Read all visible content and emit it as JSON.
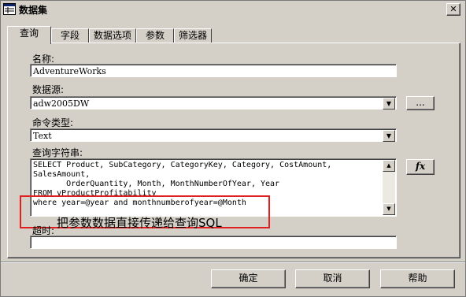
{
  "window": {
    "title": "数据集",
    "close_glyph": "✕"
  },
  "tabs": [
    {
      "label": "查询",
      "active": true
    },
    {
      "label": "字段"
    },
    {
      "label": "数据选项"
    },
    {
      "label": "参数"
    },
    {
      "label": "筛选器"
    }
  ],
  "form": {
    "name_label": "名称:",
    "name_value": "AdventureWorks",
    "datasource_label": "数据源:",
    "datasource_value": "adw2005DW",
    "datasource_browse": "...",
    "cmdtype_label": "命令类型:",
    "cmdtype_value": "Text",
    "query_label": "查询字符串:",
    "query_lines": [
      "SELECT Product, SubCategory, CategoryKey, Category, CostAmount,",
      "SalesAmount,",
      "       OrderQuantity, Month, MonthNumberOfYear, Year",
      "FROM vProductProfitability",
      "where year=@year and monthnumberofyear=@Month"
    ],
    "fx_label": "fx",
    "timeout_label": "超时:",
    "timeout_value": ""
  },
  "annotation": {
    "text": "把参数数据直接传递给查询SQL",
    "color": "#e02020"
  },
  "buttons": {
    "ok": "确定",
    "cancel": "取消",
    "help": "帮助"
  }
}
